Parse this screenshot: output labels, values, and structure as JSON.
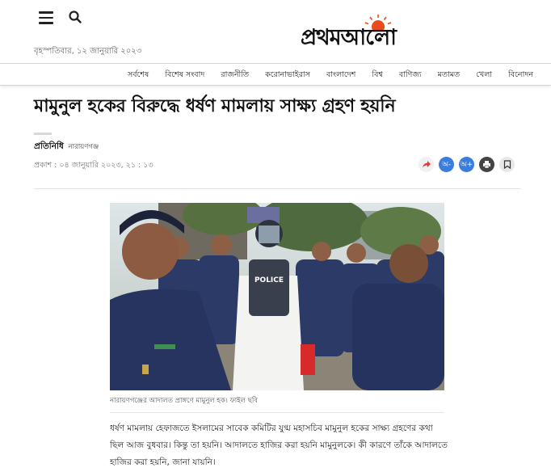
{
  "header": {
    "date": "বৃহস্পতিবার, ১২ জানুয়ারি ২০২৩",
    "logo_text": "প্রথমআলো",
    "menu_icon": "hamburger-menu-icon",
    "search_icon": "search-icon"
  },
  "nav": {
    "items": [
      "সর্বশেষ",
      "বিশেষ সংবাদ",
      "রাজনীতি",
      "করোনাভাইরাস",
      "বাংলাদেশ",
      "বিশ্ব",
      "বাণিজ্য",
      "মতামত",
      "খেলা",
      "বিনোদন"
    ]
  },
  "article": {
    "headline": "মামুনুল হকের বিরুদ্ধে ধর্ষণ মামলায় সাক্ষ্য গ্রহণ হয়নি",
    "author": "প্রতিনিধি",
    "author_place": "নারায়ণগঞ্জ",
    "published": "প্রকাশ : ০৪ জানুয়ারি ২০২৩, ২১ : ১৩",
    "share_buttons": {
      "font_minus": "অ-",
      "font_plus": "অ+"
    },
    "photo_vest_text": "POLICE",
    "caption": "নারায়ণগঞ্জের আদালত প্রাঙ্গণে মামুনুল হক। ফাইল ছবি",
    "body": "ধর্ষণ মামলায় হেফাজতে ইসলামের সাবেক কমিটির যুগ্ম মহাসচিব মামুনুল হকের সাক্ষ্য গ্রহণের কথা ছিল আজ বুধবার। কিন্তু তা হয়নি। আদালতে হাজির করা হয়নি মামুনুলকে। কী কারণে তাঁকে আদালতে হাজির করা হয়নি, জানা যায়নি।"
  },
  "colors": {
    "logo_sun": "#e94b1d",
    "share_red": "#e5383b",
    "font_button_blue": "#3b7ddd",
    "police_uniform": "#2b3a66"
  }
}
